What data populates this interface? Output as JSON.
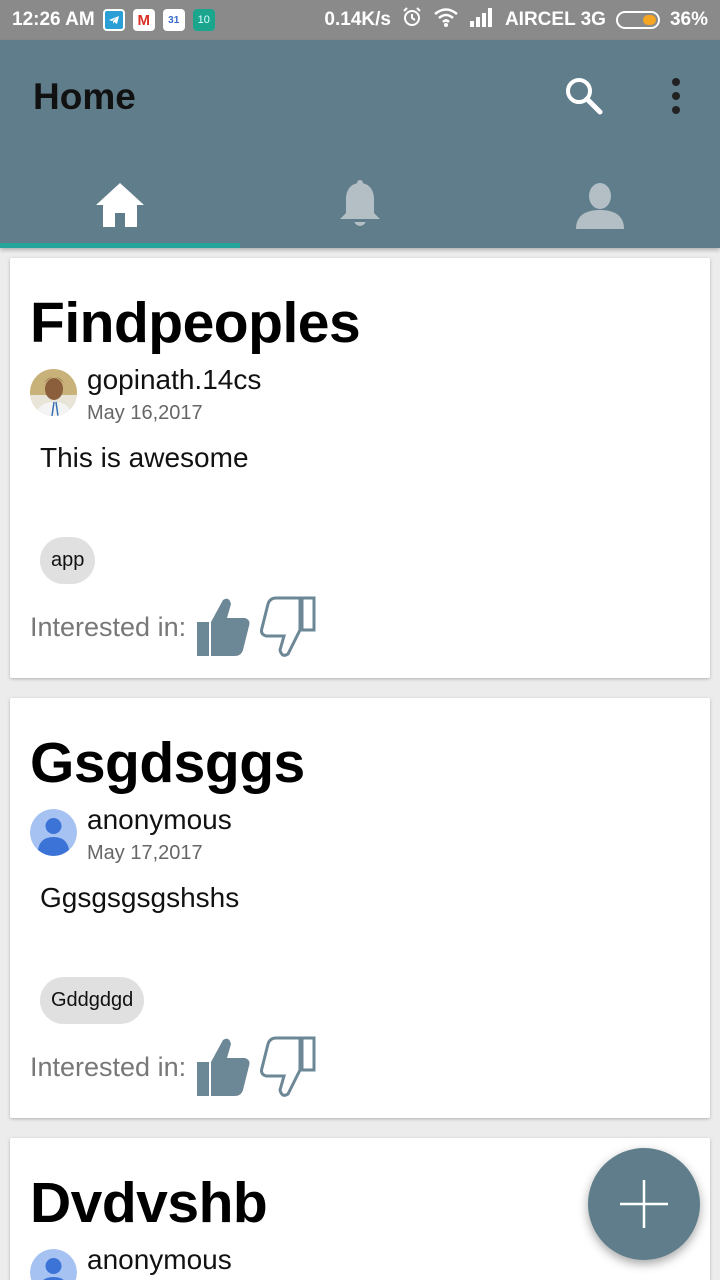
{
  "status_bar": {
    "time": "12:26 AM",
    "notification_icons": [
      "telegram-icon",
      "gmail-icon",
      "calendar-icon",
      "ten-icon"
    ],
    "calendar_day": "31",
    "ten_badge": "10",
    "gmail_letter": "M",
    "network_speed": "0.14K/s",
    "carrier": "AIRCEL 3G",
    "battery_percent": "36%",
    "battery_level": 0.36
  },
  "appbar": {
    "title": "Home",
    "background": "#607d8b",
    "tabs": [
      {
        "icon": "home-icon",
        "selected": true
      },
      {
        "icon": "bell-icon",
        "selected": false
      },
      {
        "icon": "person-icon",
        "selected": false
      }
    ],
    "indicator_color": "#26a69a"
  },
  "posts": [
    {
      "title": "Findpeoples",
      "author": "gopinath.14cs",
      "avatar": "user-photo",
      "date": "May 16,2017",
      "body": "This is awesome",
      "tag": "app",
      "interest_label": "Interested in:"
    },
    {
      "title": "Gsgdsggs",
      "author": "anonymous",
      "avatar": "default-avatar",
      "date": "May 17,2017",
      "body": "Ggsgsgsgshshs",
      "tag": "Gddgdgd",
      "interest_label": "Interested in:"
    },
    {
      "title": "Dvdvshb",
      "author": "anonymous",
      "avatar": "default-avatar"
    }
  ],
  "fab": {
    "icon": "plus-icon",
    "color": "#607d8b"
  }
}
